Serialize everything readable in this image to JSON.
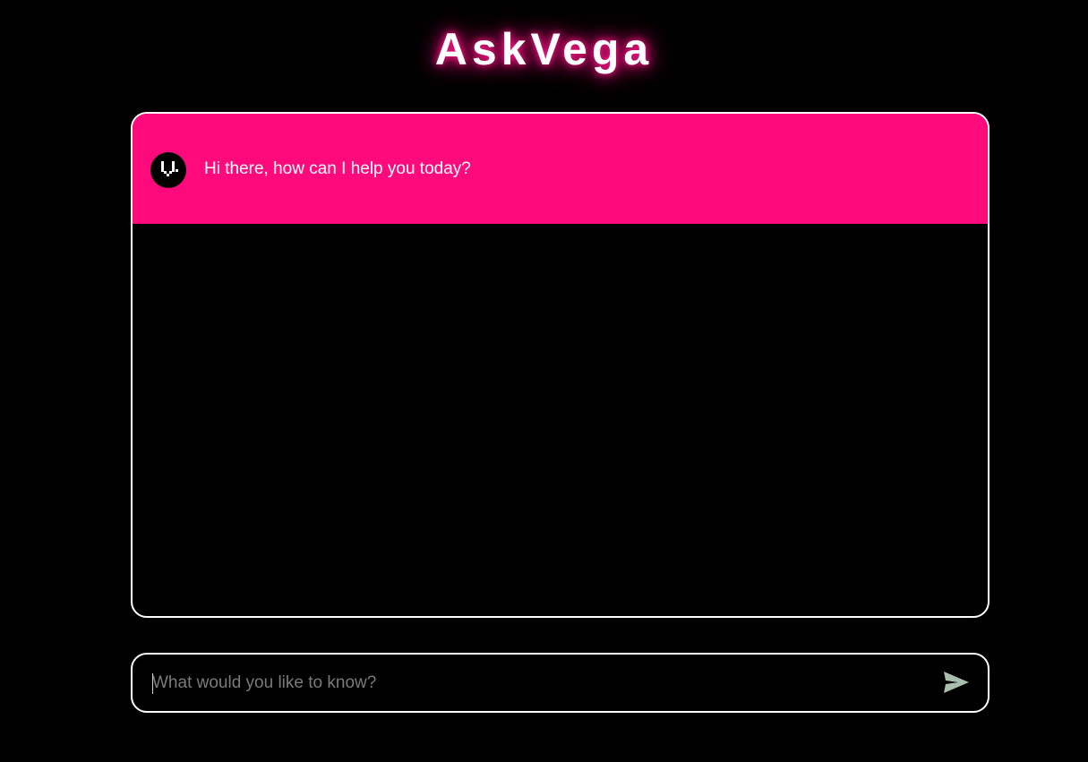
{
  "app": {
    "title": "AskVega"
  },
  "chat": {
    "messages": [
      {
        "sender": "assistant",
        "avatar_icon": "vega-logo-icon",
        "text": "Hi there, how can I help you today?"
      }
    ]
  },
  "input": {
    "value": "",
    "placeholder": "What would you like to know?",
    "send_icon": "send-icon"
  },
  "colors": {
    "background": "#000000",
    "accent": "#ff0a7d",
    "border": "#ffffff",
    "send_icon": "#a9bfae",
    "placeholder": "#7a7a7a"
  }
}
